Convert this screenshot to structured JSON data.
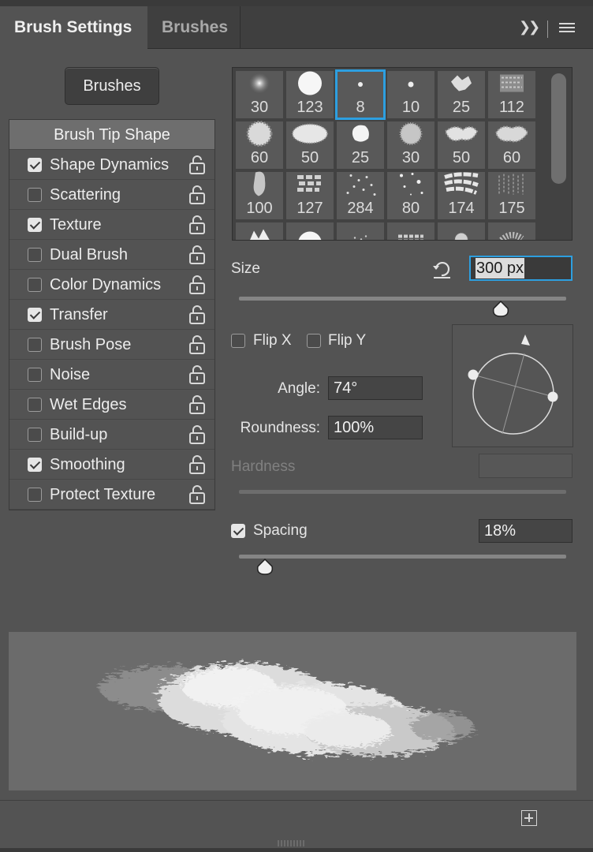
{
  "tabs": {
    "active": "Brush Settings",
    "inactive": "Brushes"
  },
  "brushes_button": "Brushes",
  "options": {
    "header": "Brush Tip Shape",
    "items": [
      {
        "label": "Shape Dynamics",
        "checked": true
      },
      {
        "label": "Scattering",
        "checked": false
      },
      {
        "label": "Texture",
        "checked": true
      },
      {
        "label": "Dual Brush",
        "checked": false
      },
      {
        "label": "Color Dynamics",
        "checked": false
      },
      {
        "label": "Transfer",
        "checked": true
      },
      {
        "label": "Brush Pose",
        "checked": false
      },
      {
        "label": "Noise",
        "checked": false
      },
      {
        "label": "Wet Edges",
        "checked": false
      },
      {
        "label": "Build-up",
        "checked": false
      },
      {
        "label": "Smoothing",
        "checked": true
      },
      {
        "label": "Protect Texture",
        "checked": false
      }
    ]
  },
  "presets": {
    "selected_index": 2,
    "sizes": [
      "30",
      "123",
      "8",
      "10",
      "25",
      "112",
      "60",
      "50",
      "25",
      "30",
      "50",
      "60",
      "100",
      "127",
      "284",
      "80",
      "174",
      "175"
    ]
  },
  "size": {
    "label": "Size",
    "value": "300 px",
    "slider_fraction": 0.8
  },
  "flip": {
    "x_label": "Flip X",
    "y_label": "Flip Y",
    "x_checked": false,
    "y_checked": false
  },
  "angle": {
    "label": "Angle:",
    "value": "74°"
  },
  "roundness": {
    "label": "Roundness:",
    "value": "100%"
  },
  "hardness": {
    "label": "Hardness",
    "value": ""
  },
  "spacing": {
    "label": "Spacing",
    "checked": true,
    "value": "18%",
    "slider_fraction": 0.08
  },
  "icons": {
    "expand": "double-chevron-right-icon",
    "menu": "hamburger-menu-icon",
    "lock": "unlock-icon",
    "reset": "reset-size-icon",
    "new": "new-brush-preset-icon"
  },
  "colors": {
    "accent": "#2d9fe0",
    "panel": "#535353",
    "tabbar": "#3f3f3f"
  }
}
